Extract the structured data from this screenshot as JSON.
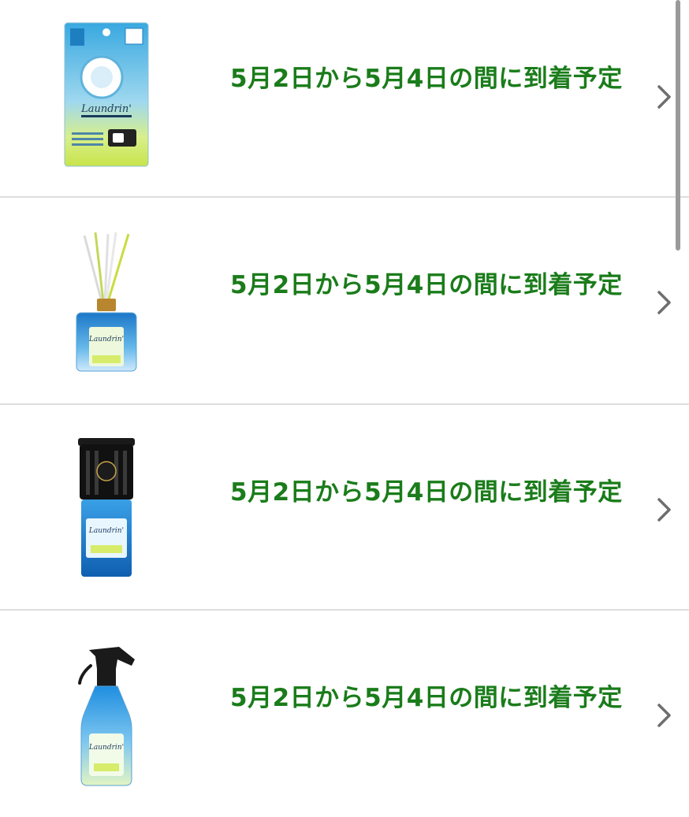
{
  "colors": {
    "delivery_text": "#1a7c1a",
    "chevron": "#6e6e6e",
    "divider": "#dedede",
    "scrollbar": "#9a9a9a"
  },
  "items": [
    {
      "delivery": "5月2日から5月4日の間に到着予定",
      "image_icon": "air-freshener-clip-package-icon",
      "brand": "Laundrin'"
    },
    {
      "delivery": "5月2日から5月4日の間に到着予定",
      "image_icon": "reed-diffuser-bottle-icon",
      "brand": "Laundrin'"
    },
    {
      "delivery": "5月2日から5月4日の間に到着予定",
      "image_icon": "room-fragrance-canister-icon",
      "brand": "Laundrin'"
    },
    {
      "delivery": "5月2日から5月4日の間に到着予定",
      "image_icon": "fabric-mist-spray-bottle-icon",
      "brand": "Laundrin'"
    }
  ]
}
